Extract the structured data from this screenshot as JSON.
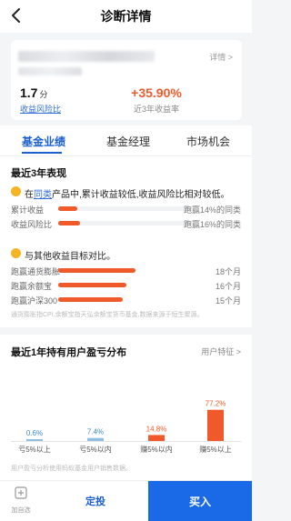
{
  "nav": {
    "title": "诊断详情"
  },
  "summary": {
    "detail_link": "详情 >",
    "score_value": "1.7",
    "score_unit": "分",
    "score_label": "收益风险比",
    "rate_value": "+35.90%",
    "rate_label": "近3年收益率"
  },
  "tabs": [
    {
      "label": "基金业绩",
      "active": true
    },
    {
      "label": "基金经理",
      "active": false
    },
    {
      "label": "市场机会",
      "active": false
    }
  ],
  "performance": {
    "title": "最近3年表现",
    "peer_prefix": "在",
    "peer_link": "同类",
    "peer_suffix": "产品中,累计收益较低,收益风险比相对较低。",
    "peer_metrics": [
      {
        "label": "累计收益",
        "right": "跑赢14%的同类",
        "fraction": 0.14
      },
      {
        "label": "收益风险比",
        "right": "跑赢16%的同类",
        "fraction": 0.16
      }
    ],
    "target_sentence": "与其他收益目标对比。",
    "target_metrics": [
      {
        "label": "跑赢通货膨胀",
        "right": "18个月",
        "fraction": 0.5
      },
      {
        "label": "跑赢余额宝",
        "right": "16个月",
        "fraction": 0.444
      },
      {
        "label": "跑赢沪深300",
        "right": "15个月",
        "fraction": 0.417
      }
    ],
    "source_note": "通货膨胀指CPI,余额宝指天弘余额宝货币基金,数据来源于恒生聚源。"
  },
  "distribution": {
    "title": "最近1年持有用户盈亏分布",
    "feature_link": "用户特征 >",
    "note": "用户盈亏分析使用蚂蚁基金用户销售数据。",
    "accent": "#f05a2a",
    "chart_data": {
      "type": "bar",
      "categories": [
        "亏5%以上",
        "亏5%以内",
        "赚5%以内",
        "赚5%以上"
      ],
      "values": [
        0.6,
        7.4,
        14.8,
        77.2
      ],
      "value_labels": [
        "0.6%",
        "7.4%",
        "14.8%",
        "77.2%"
      ],
      "ylim": [
        0,
        100
      ]
    }
  },
  "bottom": {
    "watch_label": "加自选",
    "auto_invest": "定投",
    "buy": "买入"
  }
}
